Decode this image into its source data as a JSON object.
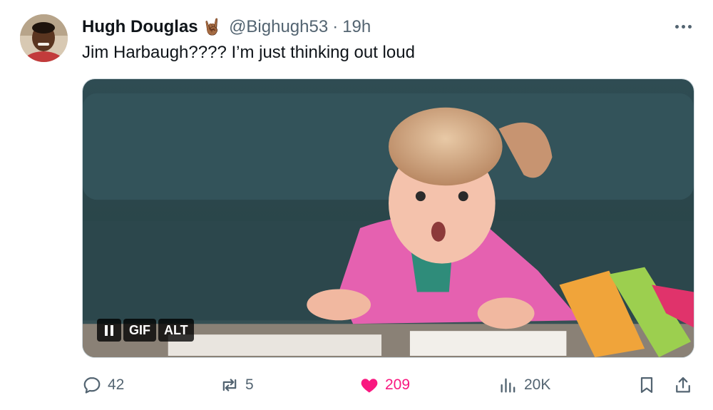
{
  "tweet": {
    "author": {
      "display_name": "Hugh Douglas",
      "badge_emoji": "🤘🏾",
      "handle": "@Bighugh53",
      "separator": "·",
      "time": "19h"
    },
    "text": "Jim Harbaugh???? I’m just thinking out loud",
    "media": {
      "type": "gif",
      "pause_icon": "pause-icon",
      "gif_label": "GIF",
      "alt_label": "ALT"
    },
    "actions": {
      "replies": "42",
      "reposts": "5",
      "likes": "209",
      "views": "20K"
    },
    "colors": {
      "like_active": "#f91880",
      "secondary_text": "#536471",
      "primary_text": "#0f1419"
    }
  }
}
